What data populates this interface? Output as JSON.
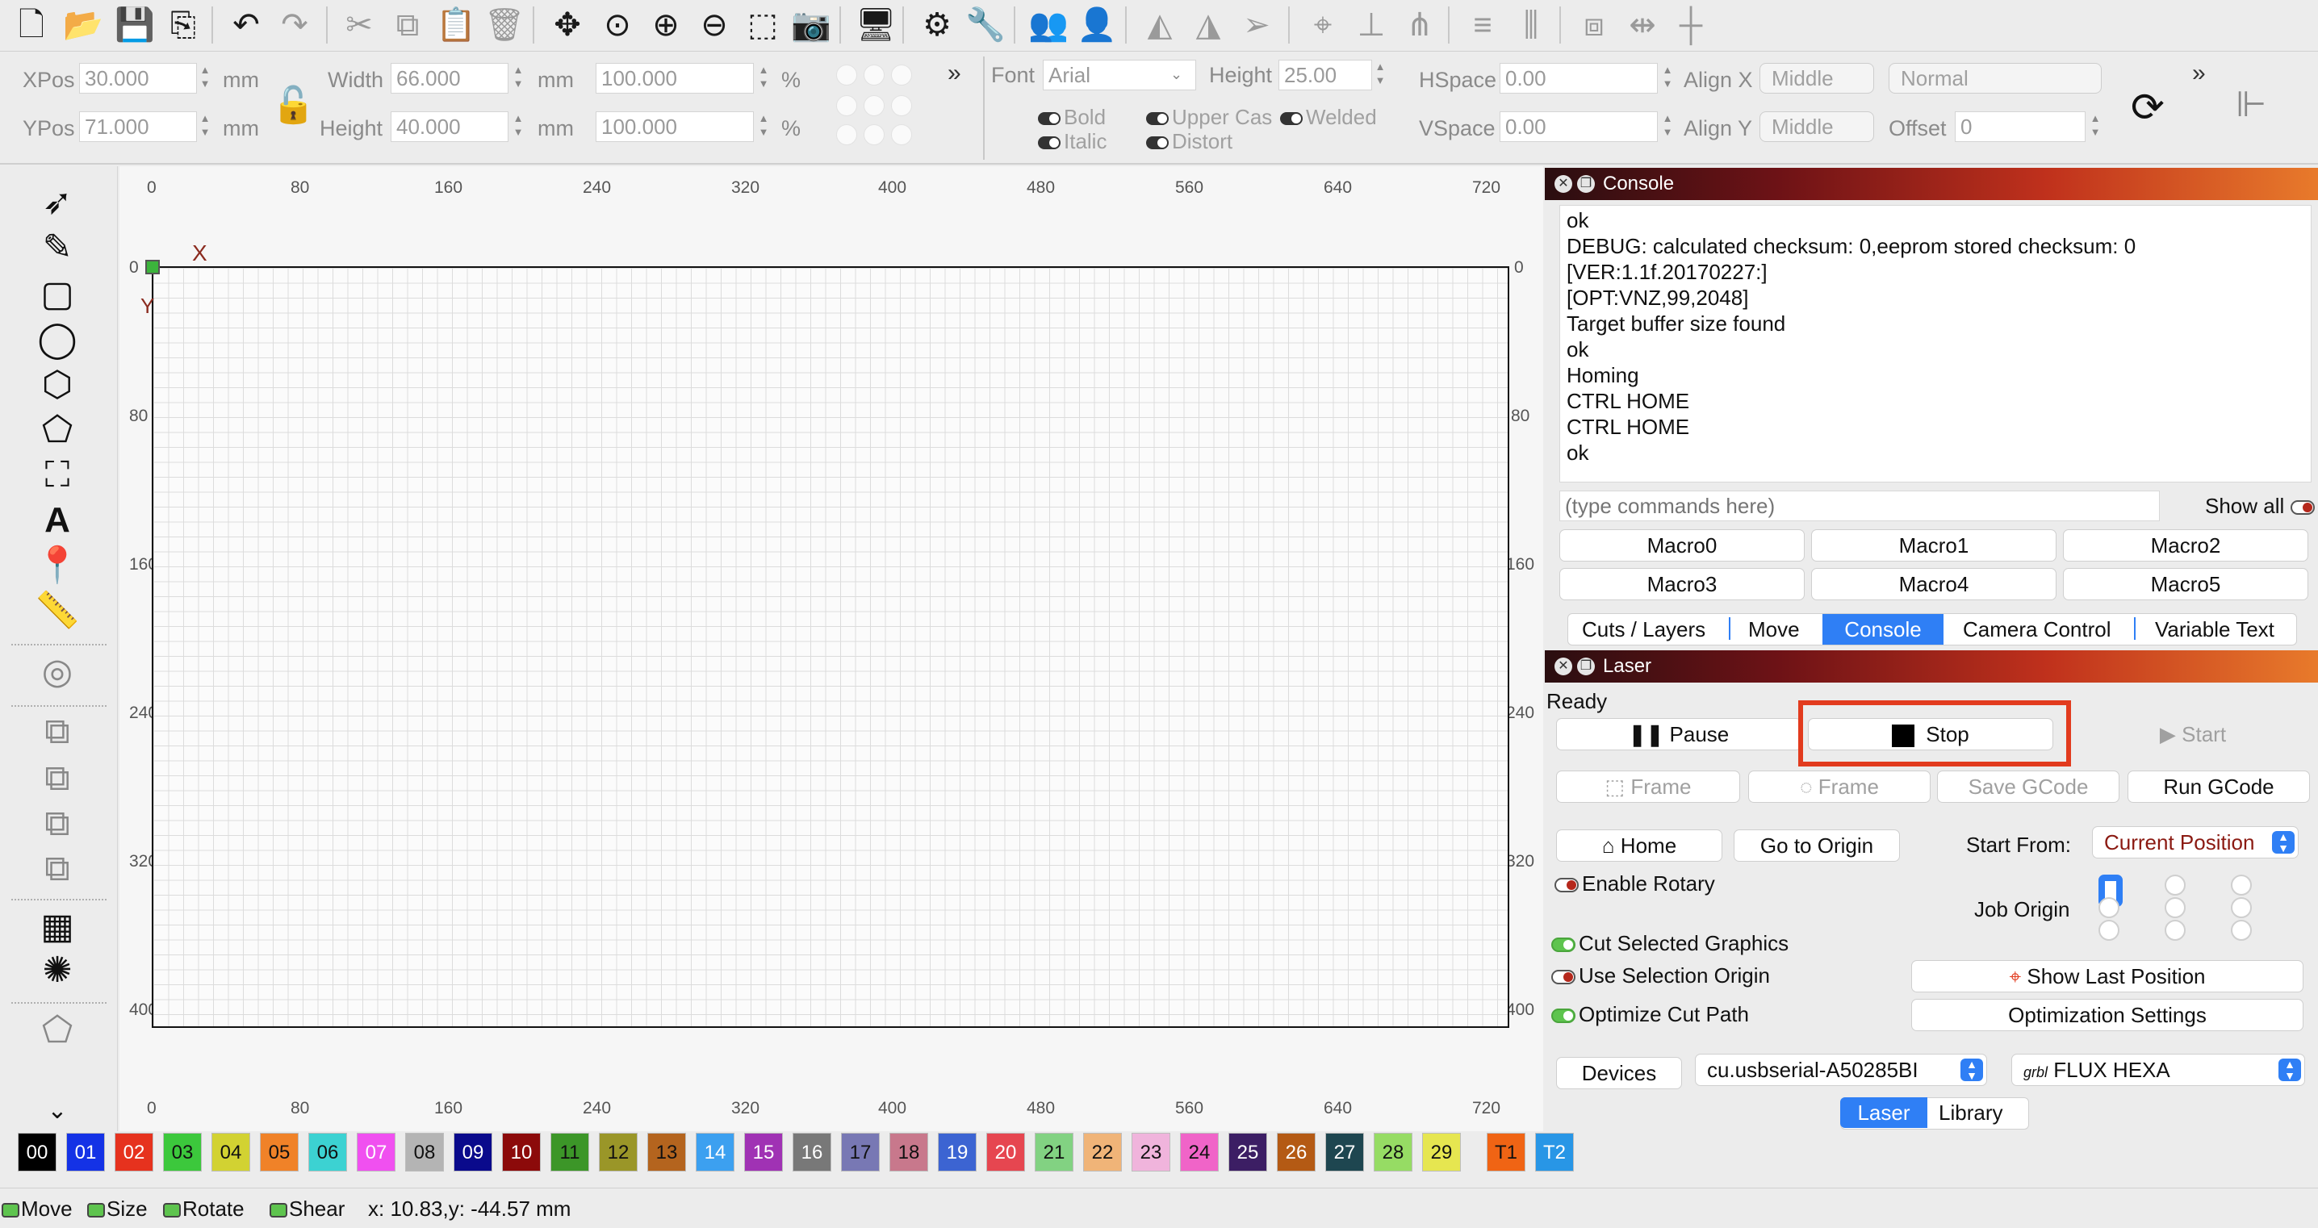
{
  "toolbar": {
    "icons": [
      "new-file",
      "open-folder",
      "save",
      "export",
      "undo",
      "redo",
      "cut",
      "copy",
      "paste",
      "delete",
      "move",
      "zoom-fit",
      "zoom-in",
      "zoom-out",
      "select-rect",
      "camera",
      "monitor",
      "settings",
      "tools",
      "users",
      "user",
      "mirror-h",
      "mirror-v",
      "send",
      "target",
      "align",
      "distribute",
      "align-2",
      "align-3",
      "boolean",
      "resize",
      "center"
    ]
  },
  "props": {
    "xpos_label": "XPos",
    "xpos_value": "30.000",
    "ypos_label": "YPos",
    "ypos_value": "71.000",
    "unit": "mm",
    "width_label": "Width",
    "width_value": "66.000",
    "height_label": "Height",
    "height_value": "40.000",
    "wpct_value": "100.000",
    "hpct_value": "100.000",
    "pct": "%",
    "font_label": "Font",
    "font_value": "Arial",
    "fheight_label": "Height",
    "fheight_value": "25.00",
    "bold": "Bold",
    "italic": "Italic",
    "upper": "Upper Cas",
    "welded": "Welded",
    "distort": "Distort",
    "hspace_label": "HSpace",
    "hspace_value": "0.00",
    "vspace_label": "VSpace",
    "vspace_value": "0.00",
    "alignx_label": "Align X",
    "alignx_value": "Middle",
    "aligny_label": "Align Y",
    "aligny_value": "Middle",
    "normal_value": "Normal",
    "offset_label": "Offset",
    "offset_value": "0",
    "more": "»"
  },
  "ruler": {
    "x": [
      "0",
      "80",
      "160",
      "240",
      "320",
      "400",
      "480",
      "560",
      "640",
      "720"
    ],
    "y": [
      "0",
      "80",
      "160",
      "240",
      "320",
      "400"
    ]
  },
  "canvas": {
    "axis_x": "X",
    "axis_y": "Y"
  },
  "console": {
    "title": "Console",
    "lines": [
      "ok",
      "DEBUG: calculated checksum: 0,eeprom stored checksum: 0",
      "[VER:1.1f.20170227:]",
      "[OPT:VNZ,99,2048]",
      "Target buffer size found",
      "ok",
      "Homing",
      "CTRL HOME",
      "CTRL HOME",
      "ok"
    ],
    "placeholder": "(type commands here)",
    "show_all": "Show all",
    "macros": [
      "Macro0",
      "Macro1",
      "Macro2",
      "Macro3",
      "Macro4",
      "Macro5"
    ],
    "tabs": [
      "Cuts / Layers",
      "Move",
      "Console",
      "Camera Control",
      "Variable Text"
    ]
  },
  "laser": {
    "title": "Laser",
    "status": "Ready",
    "pause": "Pause",
    "stop": "Stop",
    "start": "Start",
    "frame1": "Frame",
    "frame2": "Frame",
    "save_gcode": "Save GCode",
    "run_gcode": "Run GCode",
    "home": "Home",
    "go_origin": "Go to Origin",
    "start_from": "Start From:",
    "start_from_value": "Current Position",
    "enable_rotary": "Enable Rotary",
    "job_origin": "Job Origin",
    "cut_selected": "Cut Selected Graphics",
    "use_sel_origin": "Use Selection Origin",
    "show_last": "Show Last Position",
    "optimize": "Optimize Cut Path",
    "opt_settings": "Optimization Settings",
    "devices": "Devices",
    "port": "cu.usbserial-A50285BI",
    "device": "FLUX HEXA",
    "grbl": "grbl",
    "tabs": [
      "Laser",
      "Library"
    ]
  },
  "palette": [
    {
      "id": "00",
      "c": "#000000",
      "t": "#ffffff"
    },
    {
      "id": "01",
      "c": "#1432e6",
      "t": "#ffffff"
    },
    {
      "id": "02",
      "c": "#e6321e",
      "t": "#ffffff"
    },
    {
      "id": "03",
      "c": "#3cc83c",
      "t": "#111"
    },
    {
      "id": "04",
      "c": "#d2d232",
      "t": "#111"
    },
    {
      "id": "05",
      "c": "#f08228",
      "t": "#111"
    },
    {
      "id": "06",
      "c": "#3cd2d2",
      "t": "#111"
    },
    {
      "id": "07",
      "c": "#f050f0",
      "t": "#ffffff"
    },
    {
      "id": "08",
      "c": "#b4b4b4",
      "t": "#111"
    },
    {
      "id": "09",
      "c": "#0a0a8c",
      "t": "#ffffff"
    },
    {
      "id": "10",
      "c": "#8c0a0a",
      "t": "#ffffff"
    },
    {
      "id": "11",
      "c": "#3c9628",
      "t": "#111"
    },
    {
      "id": "12",
      "c": "#9a9628",
      "t": "#111"
    },
    {
      "id": "13",
      "c": "#b4641e",
      "t": "#111"
    },
    {
      "id": "14",
      "c": "#3ca0f0",
      "t": "#ffffff"
    },
    {
      "id": "15",
      "c": "#a032b4",
      "t": "#ffffff"
    },
    {
      "id": "16",
      "c": "#787878",
      "t": "#ffffff"
    },
    {
      "id": "17",
      "c": "#7878b4",
      "t": "#111"
    },
    {
      "id": "18",
      "c": "#c8788c",
      "t": "#111"
    },
    {
      "id": "19",
      "c": "#3c64d2",
      "t": "#ffffff"
    },
    {
      "id": "20",
      "c": "#e64650",
      "t": "#ffffff"
    },
    {
      "id": "21",
      "c": "#82d282",
      "t": "#111"
    },
    {
      "id": "22",
      "c": "#f0b478",
      "t": "#111"
    },
    {
      "id": "23",
      "c": "#f0b4dc",
      "t": "#111"
    },
    {
      "id": "24",
      "c": "#f064c8",
      "t": "#111"
    },
    {
      "id": "25",
      "c": "#3c1e64",
      "t": "#ffffff"
    },
    {
      "id": "26",
      "c": "#b45a14",
      "t": "#ffffff"
    },
    {
      "id": "27",
      "c": "#1e4650",
      "t": "#ffffff"
    },
    {
      "id": "28",
      "c": "#96dc64",
      "t": "#111"
    },
    {
      "id": "29",
      "c": "#e6e650",
      "t": "#111"
    },
    {
      "id": "T1",
      "c": "#f06414",
      "t": "#111"
    },
    {
      "id": "T2",
      "c": "#2896e6",
      "t": "#ffffff"
    }
  ],
  "status": {
    "move": "Move",
    "size": "Size",
    "rotate": "Rotate",
    "shear": "Shear",
    "coords": "x: 10.83,y: -44.57 mm"
  }
}
